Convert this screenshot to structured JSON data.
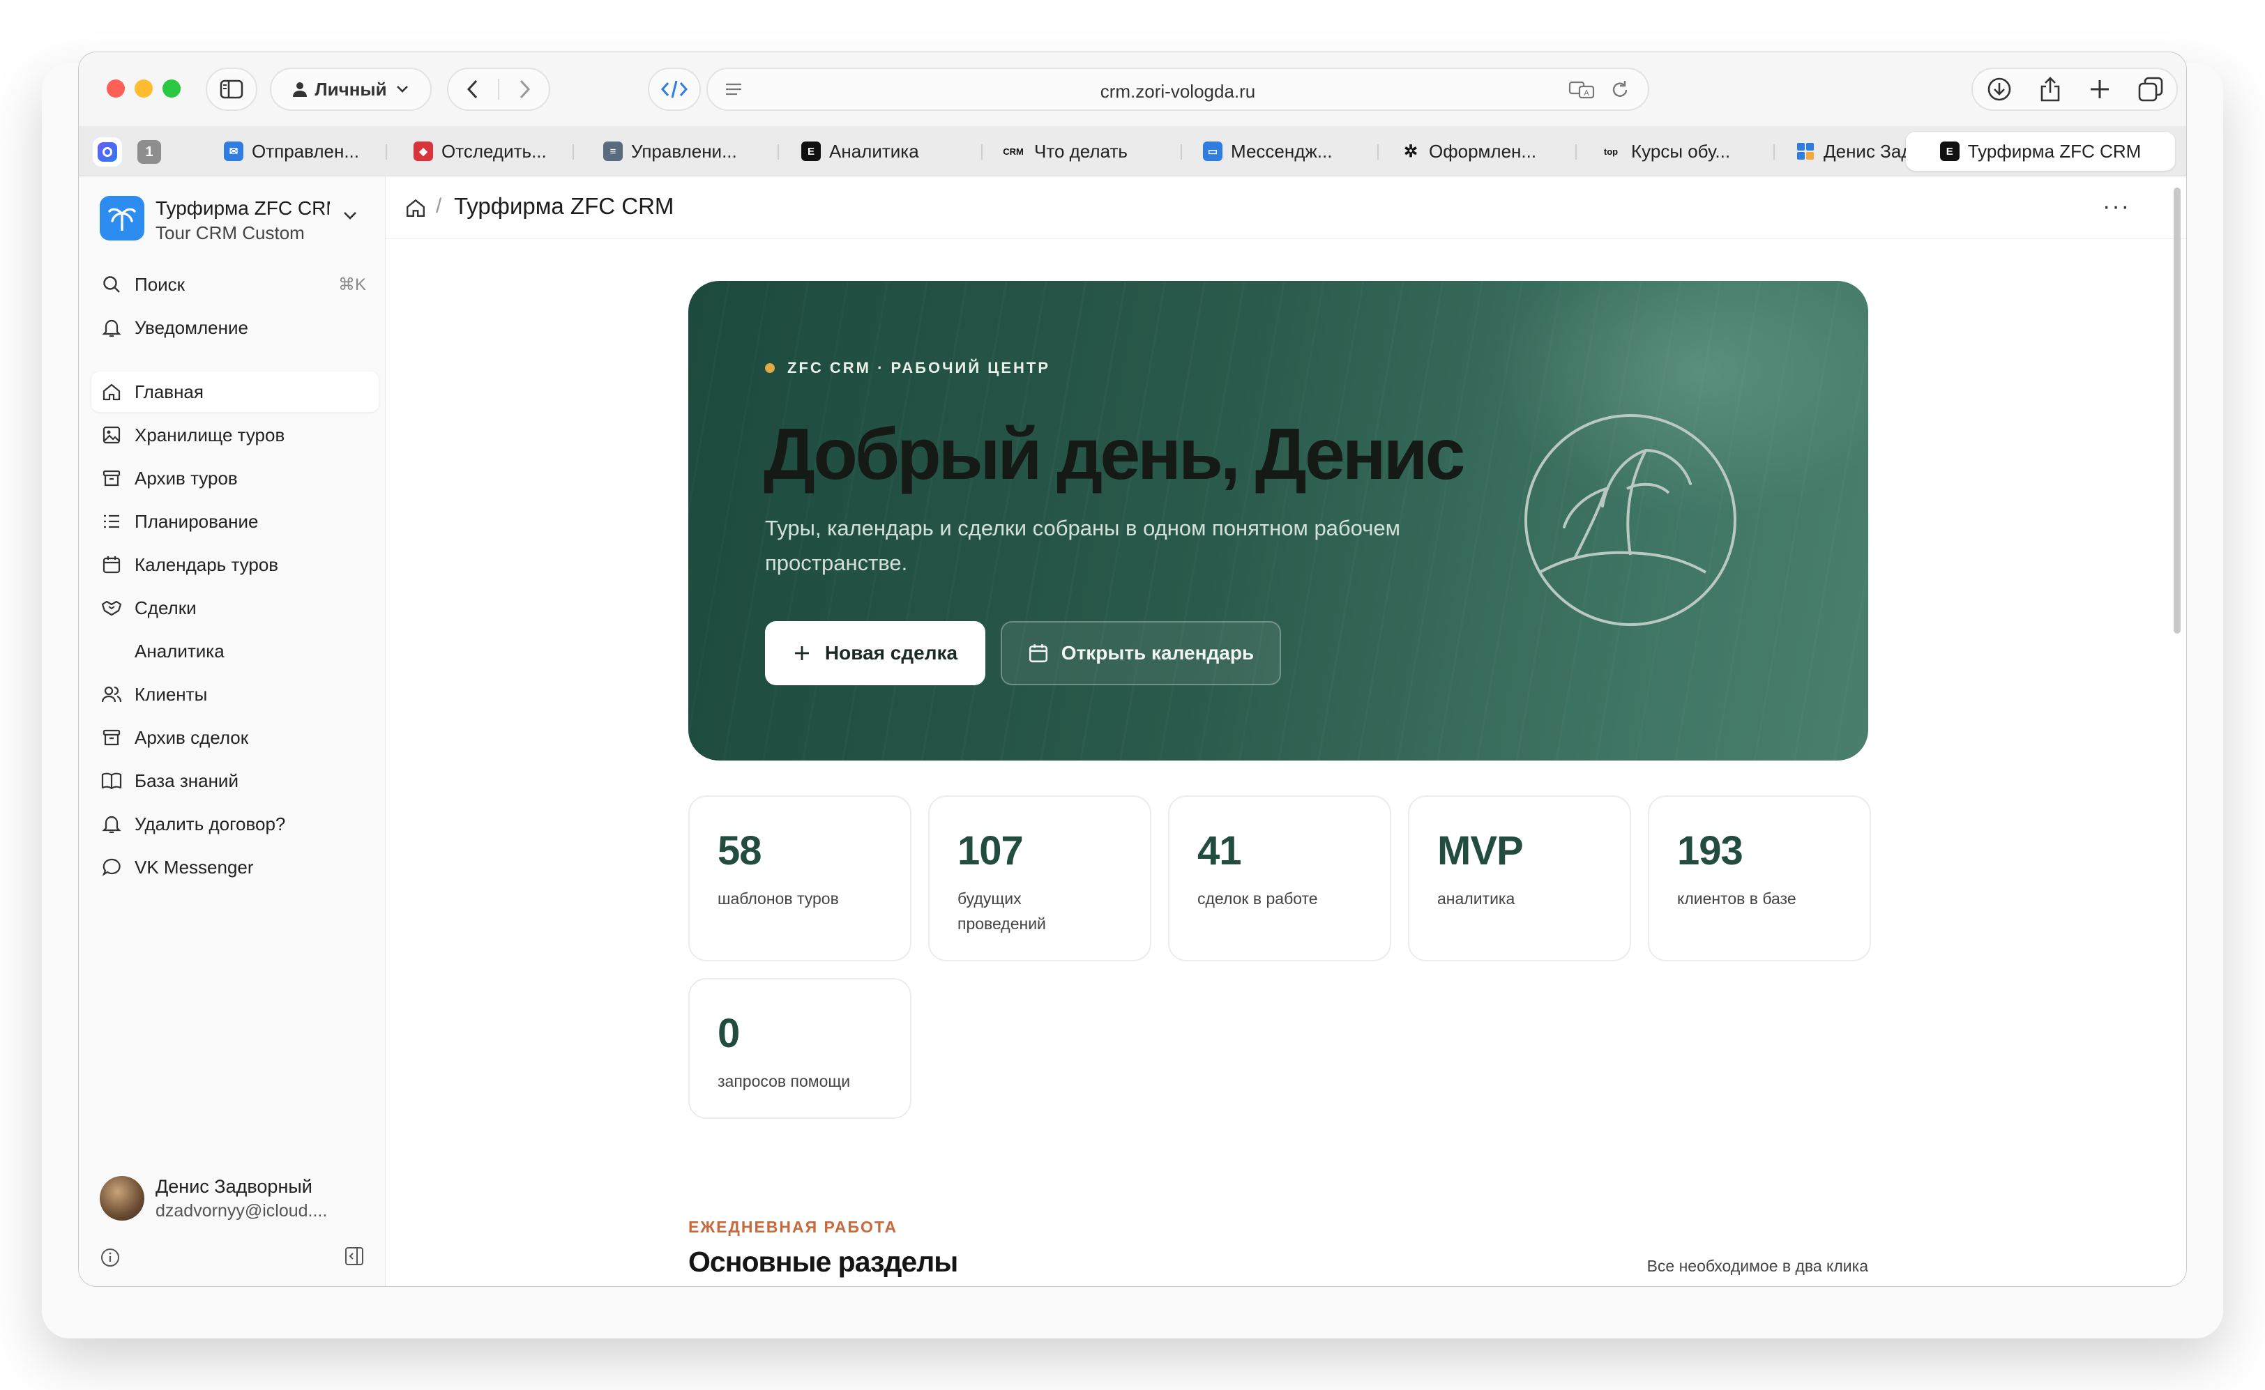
{
  "browser": {
    "profile_label": "Личный",
    "url": "crm.zori-vologda.ru",
    "tabs": [
      {
        "label": "Отправлен...",
        "icon": "mail-icon"
      },
      {
        "label": "Отследить...",
        "icon": "package-icon"
      },
      {
        "label": "Управлени...",
        "icon": "globe-icon"
      },
      {
        "label": "Аналитика",
        "icon": "e-icon"
      },
      {
        "label": "Что делать",
        "icon": "crm-icon",
        "fav_text": "CRM"
      },
      {
        "label": "Мессендж...",
        "icon": "chat-icon"
      },
      {
        "label": "Оформлен...",
        "icon": "openai-icon"
      },
      {
        "label": "Курсы обу...",
        "icon": "top-icon",
        "fav_text": "top"
      },
      {
        "label": "Денис Зад...",
        "icon": "grid-icon"
      },
      {
        "label": "Турфирма ZFC CRM",
        "icon": "e-icon"
      }
    ],
    "pinned_badge": "1"
  },
  "sidebar": {
    "workspace_name": "Турфирма ZFC CRM",
    "workspace_sub": "Tour CRM Custom",
    "search_label": "Поиск",
    "search_shortcut": "⌘K",
    "notifications_label": "Уведомление",
    "items": [
      {
        "label": "Главная",
        "icon": "home-icon",
        "active": true
      },
      {
        "label": "Хранилище туров",
        "icon": "image-icon"
      },
      {
        "label": "Архив туров",
        "icon": "archive-icon"
      },
      {
        "label": "Планирование",
        "icon": "list-icon"
      },
      {
        "label": "Календарь туров",
        "icon": "calendar-icon"
      },
      {
        "label": "Сделки",
        "icon": "handshake-icon"
      },
      {
        "label": "Аналитика",
        "icon": ""
      },
      {
        "label": "Клиенты",
        "icon": "users-icon"
      },
      {
        "label": "Архив сделок",
        "icon": "archive-icon"
      },
      {
        "label": "База знаний",
        "icon": "book-icon"
      },
      {
        "label": "Удалить договор?",
        "icon": "bell-icon"
      },
      {
        "label": "VK Messenger",
        "icon": "message-icon"
      }
    ],
    "user_name": "Денис Задворный",
    "user_email": "dzadvornyy@icloud...."
  },
  "main": {
    "breadcrumb_title": "Турфирма ZFC CRM",
    "hero": {
      "eyebrow": "ZFC CRM · РАБОЧИЙ ЦЕНТР",
      "title": "Добрый день, Денис",
      "description": "Туры, календарь и сделки собраны в одном понятном рабочем пространстве.",
      "primary_button": "Новая сделка",
      "secondary_button": "Открыть календарь"
    },
    "stats": [
      {
        "value": "58",
        "label": "шаблонов туров"
      },
      {
        "value": "107",
        "label": "будущих проведений"
      },
      {
        "value": "41",
        "label": "сделок в работе"
      },
      {
        "value": "MVP",
        "label": "аналитика"
      },
      {
        "value": "193",
        "label": "клиентов в базе"
      },
      {
        "value": "0",
        "label": "запросов помощи"
      }
    ],
    "section": {
      "eyebrow": "ЕЖЕДНЕВНАЯ РАБОТА",
      "title": "Основные разделы",
      "note": "Все необходимое в два клика"
    }
  },
  "colors": {
    "accent_green": "#214c3f",
    "hero_start": "#1d4a3e",
    "hero_end": "#4a7f6d",
    "eyebrow_orange": "#c8693c",
    "dot_gold": "#e0a94a",
    "logo_blue": "#2d8cf0"
  }
}
